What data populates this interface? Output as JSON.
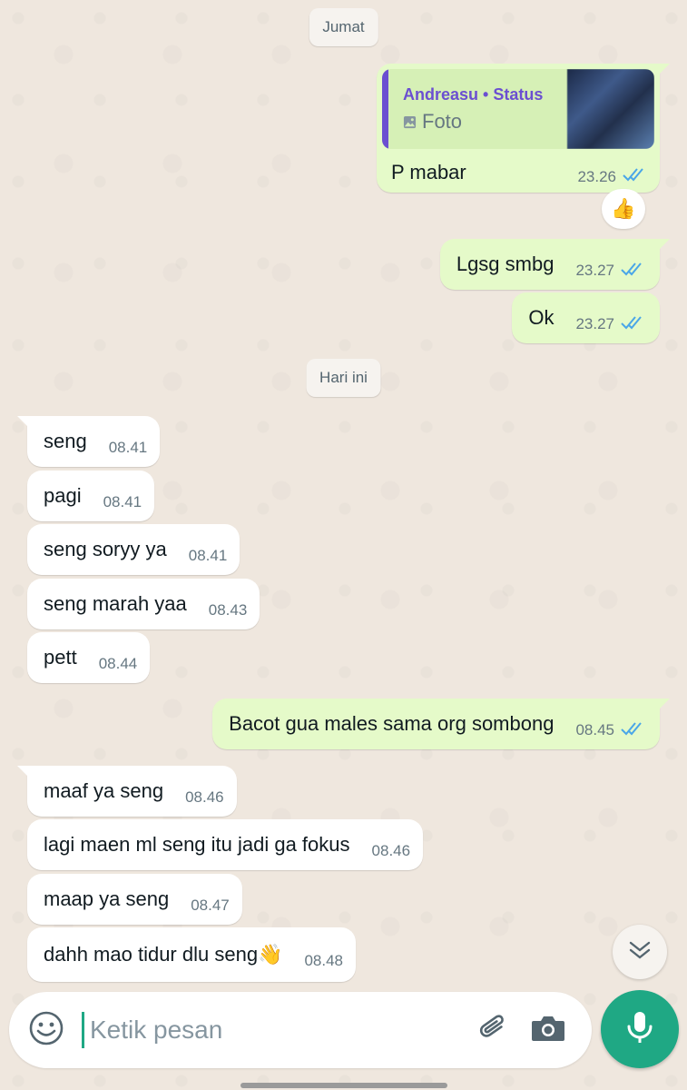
{
  "date_chips": {
    "previous": "Jumat",
    "today": "Hari ini"
  },
  "reply": {
    "author": "Andreasu",
    "separator": "•",
    "source": "Status",
    "media_type": "Foto",
    "media_icon": "image-icon",
    "text": "P mabar",
    "time": "23.26",
    "reaction": "👍"
  },
  "outgoing_1": [
    {
      "text": "Lgsg smbg",
      "time": "23.27"
    },
    {
      "text": "Ok",
      "time": "23.27"
    }
  ],
  "incoming_1": [
    {
      "text": "seng",
      "time": "08.41"
    },
    {
      "text": "pagi",
      "time": "08.41"
    },
    {
      "text": "seng soryy ya",
      "time": "08.41"
    },
    {
      "text": "seng marah yaa",
      "time": "08.43"
    },
    {
      "text": "pett",
      "time": "08.44"
    }
  ],
  "outgoing_2": [
    {
      "text": "Bacot gua males sama org sombong",
      "time": "08.45"
    }
  ],
  "incoming_2": [
    {
      "text": "maaf ya seng",
      "time": "08.46"
    },
    {
      "text": "lagi maen ml seng itu jadi ga fokus",
      "time": "08.46"
    },
    {
      "text": "maap ya seng",
      "time": "08.47"
    },
    {
      "text": "dahh mao tidur dlu seng👋",
      "time": "08.48"
    }
  ],
  "composer": {
    "placeholder": "Ketik pesan",
    "emoji_icon": "emoji-icon",
    "attach_icon": "paperclip-icon",
    "camera_icon": "camera-icon",
    "mic_icon": "microphone-icon"
  },
  "scroll_icon": "double-chevron-down-icon",
  "colors": {
    "outgoing_bubble": "#e5fac9",
    "incoming_bubble": "#ffffff",
    "read_ticks": "#4aa6e8",
    "accent": "#1fa884",
    "quote_author": "#6b4fd1"
  }
}
